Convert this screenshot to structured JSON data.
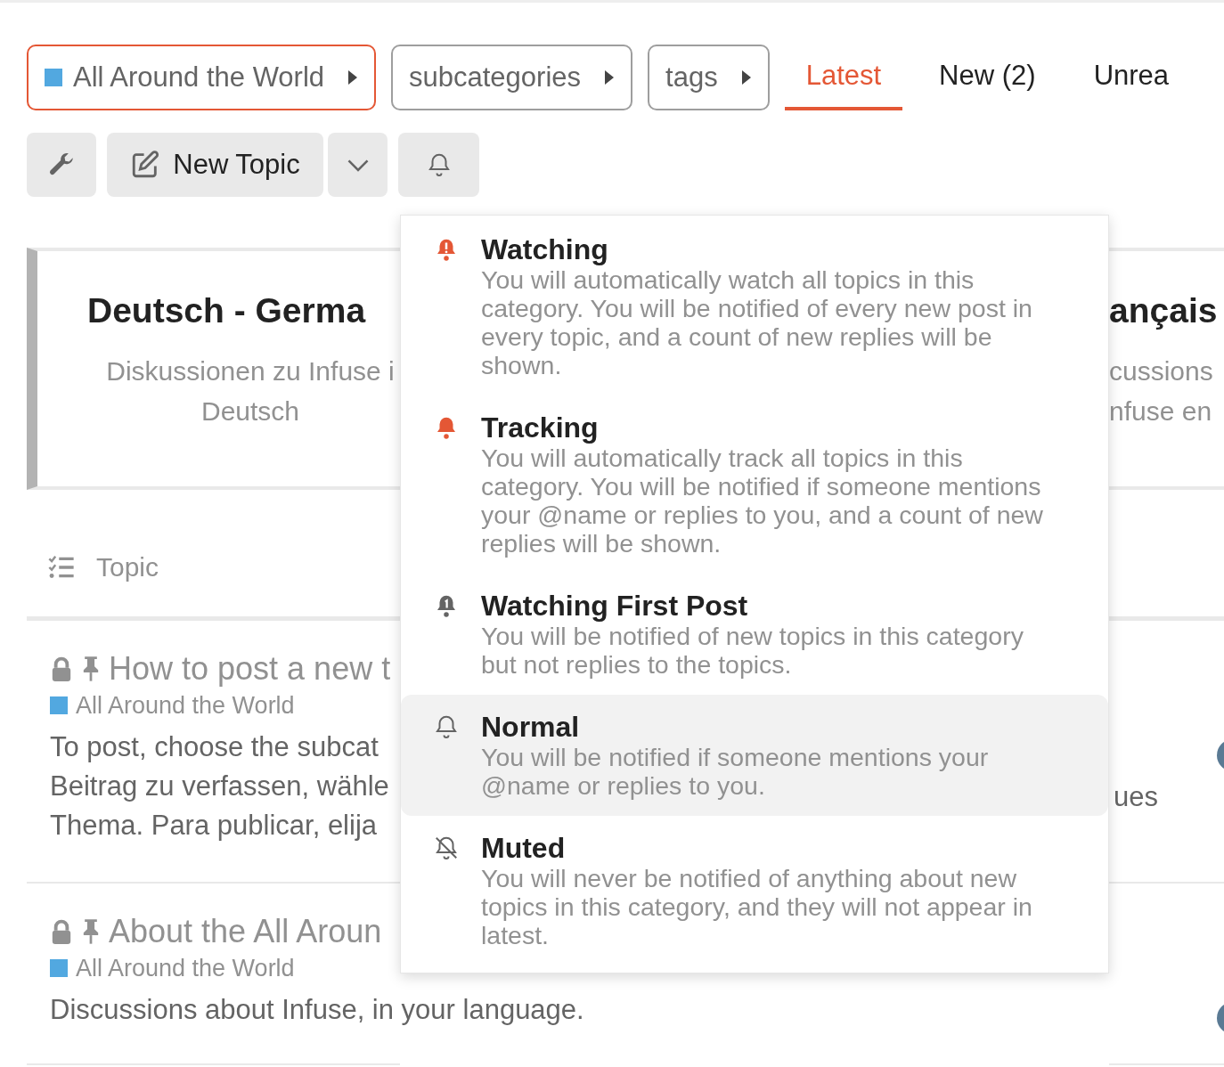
{
  "filters": [
    {
      "kind": "category",
      "label": "All Around the World",
      "color": "#52a8e0",
      "active": true
    },
    {
      "kind": "plain",
      "label": "subcategories",
      "active": false
    },
    {
      "kind": "plain",
      "label": "tags",
      "active": false
    }
  ],
  "nav_tabs": [
    {
      "label": "Latest",
      "selected": true
    },
    {
      "label": "New (2)",
      "selected": false
    },
    {
      "label": "Unrea",
      "selected": false
    }
  ],
  "toolbar": {
    "new_topic": "New Topic"
  },
  "category_cards": [
    {
      "title": "Deutsch - Germa",
      "description_lines": [
        "Diskussionen zu Infuse i",
        "Deutsch"
      ]
    },
    {
      "title": "ançais",
      "description_lines": [
        "cussions",
        "nfuse en"
      ]
    }
  ],
  "topic_header": "Topic",
  "topics": [
    {
      "title": "How to post a new t",
      "category": {
        "label": "All Around the World",
        "color": "#52a8e0"
      },
      "locked": true,
      "pinned": true,
      "excerpt_lines": [
        "To post, choose the subcat",
        "Beitrag zu verfassen, wähle",
        "Thema. Para publicar, elija"
      ],
      "right_excerpt_lines": [
        "ues"
      ]
    },
    {
      "title": "About the All Aroun",
      "category": {
        "label": "All Around the World",
        "color": "#52a8e0"
      },
      "locked": true,
      "pinned": true,
      "excerpt_lines": [
        "Discussions about Infuse, in your language."
      ]
    }
  ],
  "notification_menu": [
    {
      "kind": "watching",
      "title": "Watching",
      "description": "You will automatically watch all topics in this category. You will be notified of every new post in every topic, and a count of new replies will be shown.",
      "selected": false
    },
    {
      "kind": "tracking",
      "title": "Tracking",
      "description": "You will automatically track all topics in this category. You will be notified if someone mentions your @name or replies to you, and a count of new replies will be shown.",
      "selected": false
    },
    {
      "kind": "watching_first_post",
      "title": "Watching First Post",
      "description": "You will be notified of new topics in this category but not replies to the topics.",
      "selected": false
    },
    {
      "kind": "normal",
      "title": "Normal",
      "description": "You will be notified if someone mentions your @name or replies to you.",
      "selected": true
    },
    {
      "kind": "muted",
      "title": "Muted",
      "description": "You will never be notified of anything about new topics in this category, and they will not appear in latest.",
      "selected": false
    }
  ]
}
